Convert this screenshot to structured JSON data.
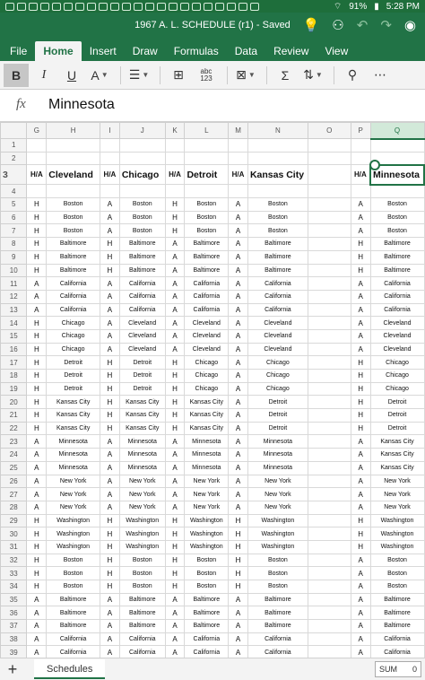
{
  "status_bar": {
    "battery": "91%",
    "time": "5:28 PM"
  },
  "title_bar": {
    "title": "1967 A. L. SCHEDULE (r1) - Saved"
  },
  "ribbon": {
    "tabs": [
      "File",
      "Home",
      "Insert",
      "Draw",
      "Formulas",
      "Data",
      "Review",
      "View"
    ],
    "active_tab": "Home",
    "abc_label": "abc",
    "num_label": "123"
  },
  "formula_bar": {
    "fx": "fx",
    "value": "Minnesota"
  },
  "grid": {
    "columns": [
      "G",
      "H",
      "I",
      "J",
      "K",
      "L",
      "M",
      "N",
      "O",
      "P",
      "Q"
    ],
    "selected_column": "Q",
    "row_numbers": [
      "1",
      "2",
      "3",
      "4",
      "5",
      "6",
      "7",
      "8",
      "9",
      "10",
      "11",
      "12",
      "13",
      "14",
      "15",
      "16",
      "17",
      "18",
      "19",
      "20",
      "21",
      "22",
      "23",
      "24",
      "25",
      "26",
      "27",
      "28",
      "29",
      "30",
      "31",
      "32",
      "33",
      "34",
      "35",
      "36",
      "37",
      "38",
      "39"
    ],
    "headers": [
      "H/A",
      "Cleveland",
      "H/A",
      "Chicago",
      "H/A",
      "Detroit",
      "H/A",
      "Kansas City",
      "",
      "H/A",
      "Minnesota"
    ],
    "rows": [
      [
        "H",
        "Boston",
        "A",
        "Boston",
        "H",
        "Boston",
        "A",
        "Boston",
        "",
        "A",
        "Boston"
      ],
      [
        "H",
        "Boston",
        "A",
        "Boston",
        "H",
        "Boston",
        "A",
        "Boston",
        "",
        "A",
        "Boston"
      ],
      [
        "H",
        "Boston",
        "A",
        "Boston",
        "H",
        "Boston",
        "A",
        "Boston",
        "",
        "A",
        "Boston"
      ],
      [
        "H",
        "Baltimore",
        "H",
        "Baltimore",
        "A",
        "Baltimore",
        "A",
        "Baltimore",
        "",
        "H",
        "Baltimore"
      ],
      [
        "H",
        "Baltimore",
        "H",
        "Baltimore",
        "A",
        "Baltimore",
        "A",
        "Baltimore",
        "",
        "H",
        "Baltimore"
      ],
      [
        "H",
        "Baltimore",
        "H",
        "Baltimore",
        "A",
        "Baltimore",
        "A",
        "Baltimore",
        "",
        "H",
        "Baltimore"
      ],
      [
        "A",
        "California",
        "A",
        "California",
        "A",
        "California",
        "A",
        "California",
        "",
        "A",
        "California"
      ],
      [
        "A",
        "California",
        "A",
        "California",
        "A",
        "California",
        "A",
        "California",
        "",
        "A",
        "California"
      ],
      [
        "A",
        "California",
        "A",
        "California",
        "A",
        "California",
        "A",
        "California",
        "",
        "A",
        "California"
      ],
      [
        "H",
        "Chicago",
        "A",
        "Cleveland",
        "A",
        "Cleveland",
        "A",
        "Cleveland",
        "",
        "A",
        "Cleveland"
      ],
      [
        "H",
        "Chicago",
        "A",
        "Cleveland",
        "A",
        "Cleveland",
        "A",
        "Cleveland",
        "",
        "A",
        "Cleveland"
      ],
      [
        "H",
        "Chicago",
        "A",
        "Cleveland",
        "A",
        "Cleveland",
        "A",
        "Cleveland",
        "",
        "A",
        "Cleveland"
      ],
      [
        "H",
        "Detroit",
        "H",
        "Detroit",
        "H",
        "Chicago",
        "A",
        "Chicago",
        "",
        "H",
        "Chicago"
      ],
      [
        "H",
        "Detroit",
        "H",
        "Detroit",
        "H",
        "Chicago",
        "A",
        "Chicago",
        "",
        "H",
        "Chicago"
      ],
      [
        "H",
        "Detroit",
        "H",
        "Detroit",
        "H",
        "Chicago",
        "A",
        "Chicago",
        "",
        "H",
        "Chicago"
      ],
      [
        "H",
        "Kansas City",
        "H",
        "Kansas City",
        "H",
        "Kansas City",
        "A",
        "Detroit",
        "",
        "H",
        "Detroit"
      ],
      [
        "H",
        "Kansas City",
        "H",
        "Kansas City",
        "H",
        "Kansas City",
        "A",
        "Detroit",
        "",
        "H",
        "Detroit"
      ],
      [
        "H",
        "Kansas City",
        "H",
        "Kansas City",
        "H",
        "Kansas City",
        "A",
        "Detroit",
        "",
        "H",
        "Detroit"
      ],
      [
        "A",
        "Minnesota",
        "A",
        "Minnesota",
        "A",
        "Minnesota",
        "A",
        "Minnesota",
        "",
        "A",
        "Kansas City"
      ],
      [
        "A",
        "Minnesota",
        "A",
        "Minnesota",
        "A",
        "Minnesota",
        "A",
        "Minnesota",
        "",
        "A",
        "Kansas City"
      ],
      [
        "A",
        "Minnesota",
        "A",
        "Minnesota",
        "A",
        "Minnesota",
        "A",
        "Minnesota",
        "",
        "A",
        "Kansas City"
      ],
      [
        "A",
        "New York",
        "A",
        "New York",
        "A",
        "New York",
        "A",
        "New York",
        "",
        "A",
        "New York"
      ],
      [
        "A",
        "New York",
        "A",
        "New York",
        "A",
        "New York",
        "A",
        "New York",
        "",
        "A",
        "New York"
      ],
      [
        "A",
        "New York",
        "A",
        "New York",
        "A",
        "New York",
        "A",
        "New York",
        "",
        "A",
        "New York"
      ],
      [
        "H",
        "Washington",
        "H",
        "Washington",
        "H",
        "Washington",
        "H",
        "Washington",
        "",
        "H",
        "Washington"
      ],
      [
        "H",
        "Washington",
        "H",
        "Washington",
        "H",
        "Washington",
        "H",
        "Washington",
        "",
        "H",
        "Washington"
      ],
      [
        "H",
        "Washington",
        "H",
        "Washington",
        "H",
        "Washington",
        "H",
        "Washington",
        "",
        "H",
        "Washington"
      ],
      [
        "H",
        "Boston",
        "H",
        "Boston",
        "H",
        "Boston",
        "H",
        "Boston",
        "",
        "A",
        "Boston"
      ],
      [
        "H",
        "Boston",
        "H",
        "Boston",
        "H",
        "Boston",
        "H",
        "Boston",
        "",
        "A",
        "Boston"
      ],
      [
        "H",
        "Boston",
        "H",
        "Boston",
        "H",
        "Boston",
        "H",
        "Boston",
        "",
        "A",
        "Boston"
      ],
      [
        "A",
        "Baltimore",
        "A",
        "Baltimore",
        "A",
        "Baltimore",
        "A",
        "Baltimore",
        "",
        "A",
        "Baltimore"
      ],
      [
        "A",
        "Baltimore",
        "A",
        "Baltimore",
        "A",
        "Baltimore",
        "A",
        "Baltimore",
        "",
        "A",
        "Baltimore"
      ],
      [
        "A",
        "Baltimore",
        "A",
        "Baltimore",
        "A",
        "Baltimore",
        "A",
        "Baltimore",
        "",
        "A",
        "Baltimore"
      ],
      [
        "A",
        "California",
        "A",
        "California",
        "A",
        "California",
        "A",
        "California",
        "",
        "A",
        "California"
      ],
      [
        "A",
        "California",
        "A",
        "California",
        "A",
        "California",
        "A",
        "California",
        "",
        "A",
        "California"
      ]
    ]
  },
  "sheet_bar": {
    "add": "+",
    "sheet_name": "Schedules",
    "sum_label": "SUM",
    "sum_value": "0"
  }
}
